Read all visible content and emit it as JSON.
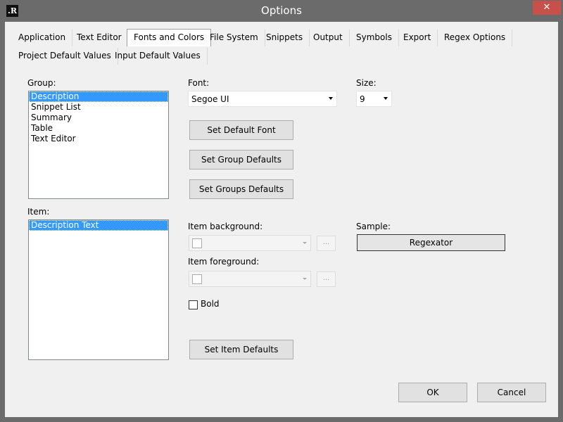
{
  "window": {
    "title": "Options",
    "close_glyph": "✕",
    "app_icon_text": ".R"
  },
  "tabs": [
    {
      "label": "Application"
    },
    {
      "label": "Text Editor"
    },
    {
      "label": "Fonts and Colors",
      "active": true
    },
    {
      "label": "File System"
    },
    {
      "label": "Snippets"
    },
    {
      "label": "Output"
    },
    {
      "label": "Symbols"
    },
    {
      "label": "Export"
    },
    {
      "label": "Regex Options"
    },
    {
      "label": "Project Default Values"
    },
    {
      "label": "Input Default Values"
    }
  ],
  "group": {
    "label": "Group:",
    "items": [
      "Description",
      "Snippet List",
      "Summary",
      "Table",
      "Text Editor"
    ],
    "selected": "Description"
  },
  "item": {
    "label": "Item:",
    "items": [
      "Description Text"
    ],
    "selected": "Description Text"
  },
  "font": {
    "label": "Font:",
    "value": "Segoe UI"
  },
  "size": {
    "label": "Size:",
    "value": "9"
  },
  "buttons": {
    "set_default_font": "Set Default Font",
    "set_group_defaults": "Set Group Defaults",
    "set_groups_defaults": "Set Groups Defaults",
    "set_item_defaults": "Set Item Defaults",
    "ok": "OK",
    "cancel": "Cancel",
    "ellipsis": "..."
  },
  "item_background": {
    "label": "Item background:"
  },
  "item_foreground": {
    "label": "Item foreground:"
  },
  "bold": {
    "label": "Bold",
    "checked": false
  },
  "sample": {
    "label": "Sample:",
    "text": "Regexator"
  },
  "colors": {
    "titlebar": "#6b6b6b",
    "close": "#c7504a",
    "selection": "#3399ff",
    "dialog": "#f0f0f0"
  }
}
